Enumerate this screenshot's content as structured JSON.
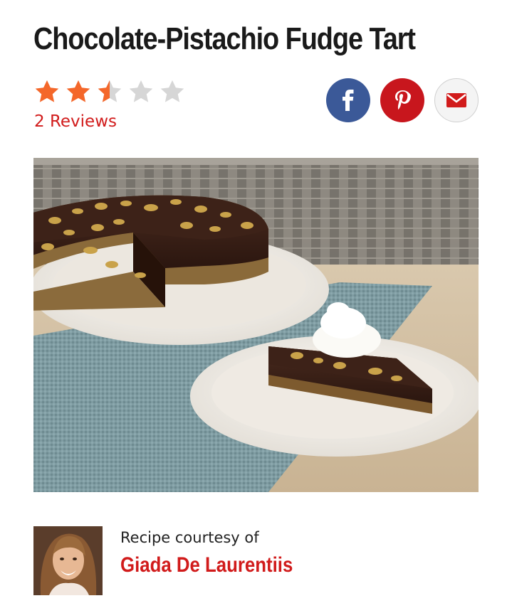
{
  "recipe": {
    "title": "Chocolate-Pistachio Fudge Tart",
    "rating": 2.5,
    "rating_max": 5,
    "reviews_label": "2 Reviews"
  },
  "share": {
    "buttons": [
      {
        "name": "facebook",
        "icon": "facebook-icon",
        "color": "#3b5998"
      },
      {
        "name": "pinterest",
        "icon": "pinterest-icon",
        "color": "#c8161d"
      },
      {
        "name": "email",
        "icon": "mail-icon",
        "color": "#c8161d"
      }
    ]
  },
  "author": {
    "courtesy_label": "Recipe courtesy of",
    "name": "Giada De Laurentiis"
  },
  "colors": {
    "accent": "#d11b1b",
    "star_filled": "#f4672a",
    "star_empty": "#d6d6d6"
  }
}
